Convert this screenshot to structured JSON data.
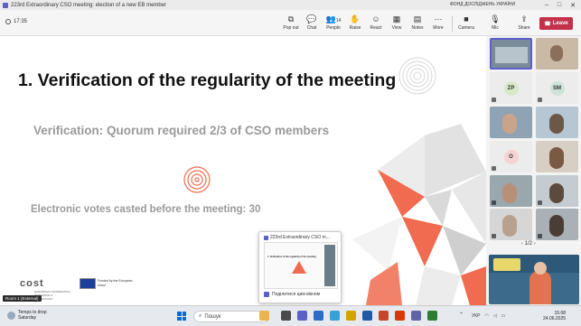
{
  "window": {
    "title": "223rd Extraordinary CSO meeting: election of a new EB member",
    "center_label": "ФОНД ДОСЛІДЖЕНЬ УКРАЇНИ"
  },
  "toolbar": {
    "timer": "17:35",
    "popout": "Pop out",
    "chat": "Chat",
    "people": "People",
    "people_count": "14",
    "raise": "Raise",
    "react": "React",
    "view": "View",
    "notes": "Notes",
    "more": "More",
    "camera": "Camera",
    "mic": "Mic",
    "share": "Share",
    "leave": "Leave"
  },
  "slide": {
    "title": "1. Verification of the regularity of the meeting",
    "verification": "Verification: Quorum required 2/3 of CSO members",
    "votes": "Electronic votes casted before the meeting: 30",
    "cost_logo": "cost",
    "cost_sub": "EUROPEAN COOPERATION IN SCIENCE & TECHNOLOGY",
    "eu_text": "Funded by the European Union"
  },
  "share_popup": {
    "title": "223rd Extraordinary CSO m...",
    "thumb_title": "1. Verification of the regularity of the meeting",
    "share_label": "Поділитися цим вікном"
  },
  "room_label": "Room 1 (External)",
  "gallery": {
    "tiles": [
      {
        "initials": "ZP",
        "bg": "#d9e8c9"
      },
      {
        "initials": "SM",
        "bg": "#cfe3d9"
      },
      {
        "initials": "O",
        "bg": "#f6d2d2"
      }
    ],
    "page": "1/2"
  },
  "taskbar": {
    "weather_title": "Temps to drop",
    "weather_sub": "Saturday",
    "search_placeholder": "Пошук",
    "lang": "УКР",
    "time": "15:08",
    "date": "24.06.2025"
  },
  "colors": {
    "leave": "#c4314b",
    "accent": "#5b5fc7",
    "orange": "#f06b4f"
  }
}
